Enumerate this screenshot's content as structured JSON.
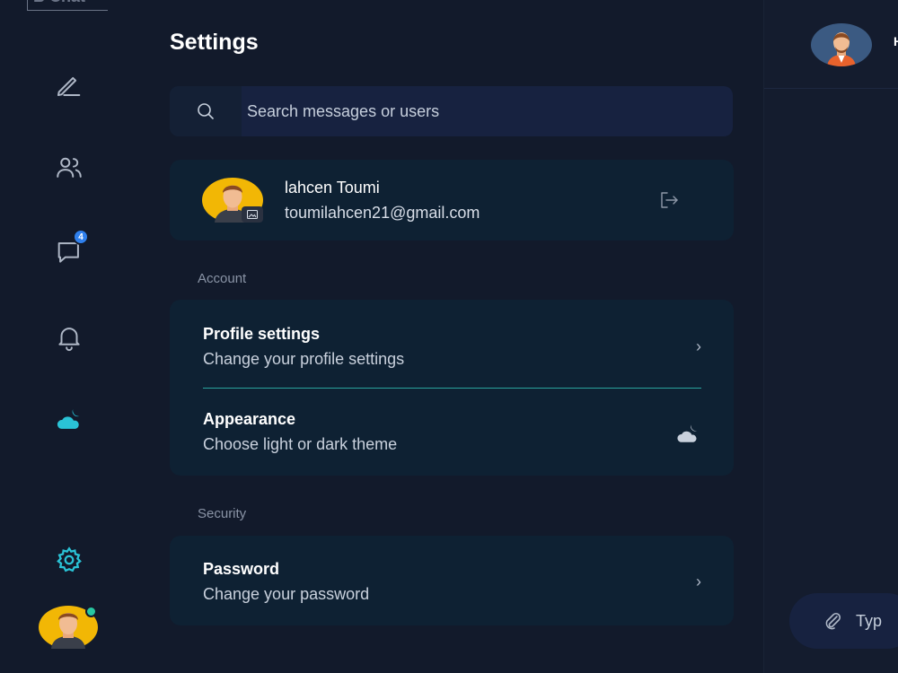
{
  "app": {
    "logo": "B Chat"
  },
  "rail": {
    "chats_badge": "4",
    "accent": "#2ac3d6"
  },
  "settings": {
    "title": "Settings",
    "search_placeholder": "Search messages or users",
    "profile": {
      "name": "lahcen Toumi",
      "email": "toumilahcen21@gmail.com"
    },
    "account_label": "Account",
    "profile_settings": {
      "title": "Profile settings",
      "subtitle": "Change your profile settings"
    },
    "appearance": {
      "title": "Appearance",
      "subtitle": "Choose light or dark theme"
    },
    "security_label": "Security",
    "password": {
      "title": "Password",
      "subtitle": "Change your password"
    }
  },
  "chat": {
    "contact_initial": "H",
    "composer_placeholder": "Typ"
  }
}
